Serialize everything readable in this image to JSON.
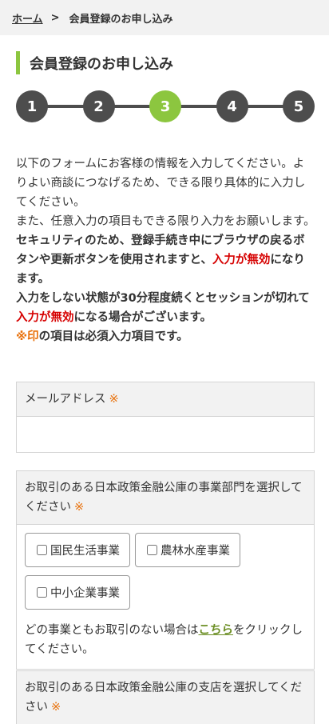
{
  "breadcrumb": {
    "home": "ホーム",
    "separator": ">",
    "current": "会員登録のお申し込み"
  },
  "page_title": "会員登録のお申し込み",
  "steps": [
    "1",
    "2",
    "3",
    "4",
    "5"
  ],
  "active_step": 3,
  "intro": {
    "p1": "以下のフォームにお客様の情報を入力してください。よりよい商談につなげるため、できる限り具体的に入力してください。",
    "p2": "また、任意入力の項目もできる限り入力をお願いします。",
    "p3_a": "セキュリティのため、登録手続き中にブラウザの戻るボタンや更新ボタンを使用されますと、",
    "p3_red": "入力が無効",
    "p3_b": "になります。",
    "p4_a": "入力をしない状態が30分程度続くとセッションが切れて",
    "p4_red": "入力が無効",
    "p4_b": "になる場合がございます。",
    "p5_mark": "※印",
    "p5_rest": "の項目は必須入力項目です。"
  },
  "required_mark": "※",
  "email": {
    "label": "メールアドレス",
    "placeholder": ""
  },
  "division": {
    "label": "お取引のある日本政策金融公庫の事業部門を選択してください",
    "options": [
      "国民生活事業",
      "農林水産事業",
      "中小企業事業"
    ],
    "note_a": "どの事業ともお取引のない場合は",
    "note_link": "こちら",
    "note_b": "をクリックしてください。"
  },
  "branch": {
    "label": "お取引のある日本政策金融公庫の支店を選択してください"
  }
}
